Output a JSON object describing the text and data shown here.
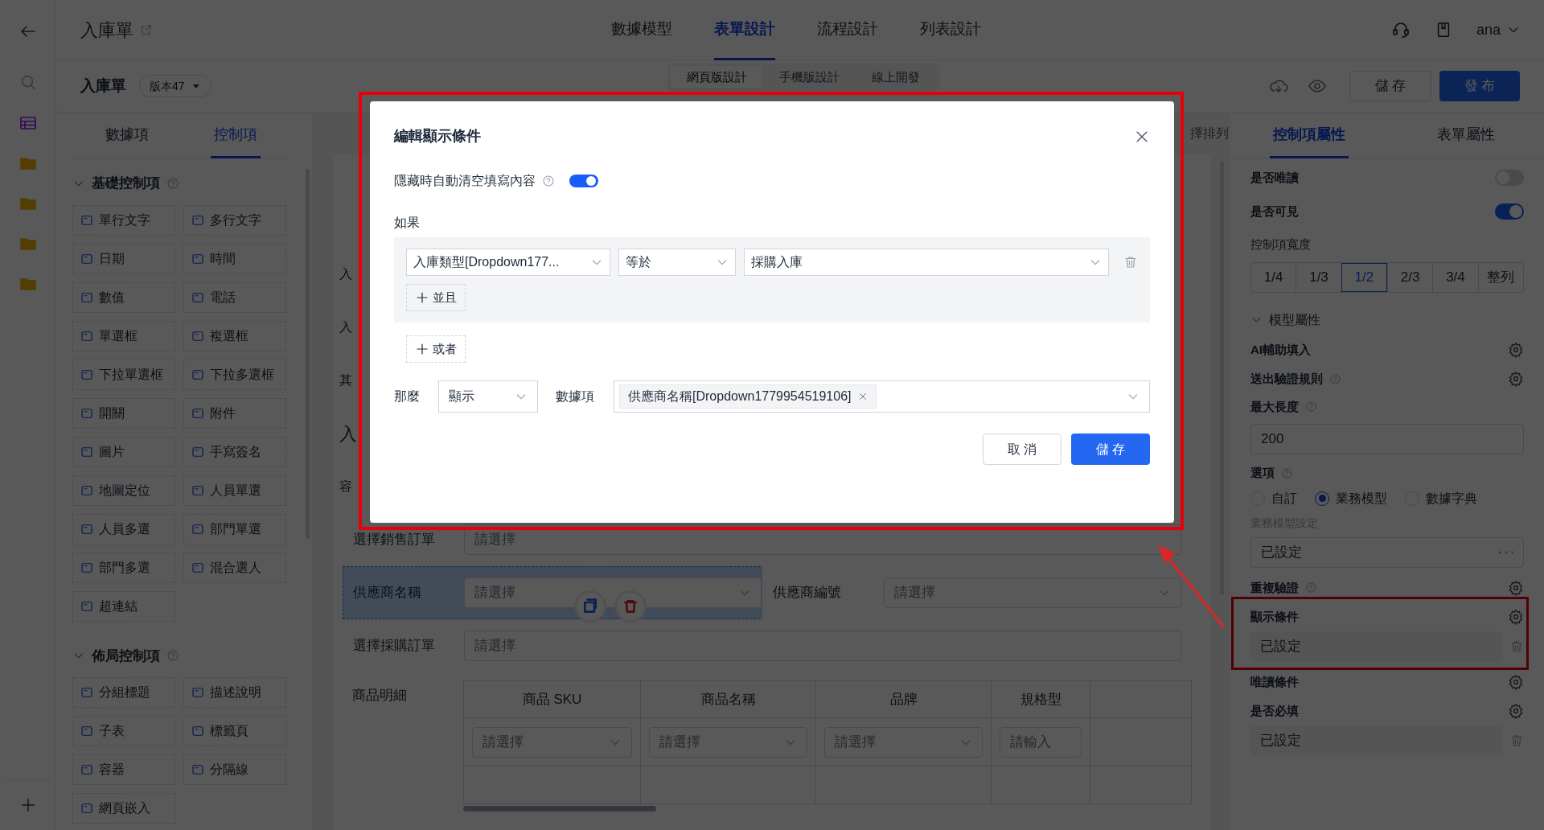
{
  "header": {
    "title": "入庫單",
    "tabs": [
      {
        "label": "數據模型",
        "selected": false
      },
      {
        "label": "表單設計",
        "selected": true
      },
      {
        "label": "流程設計",
        "selected": false
      },
      {
        "label": "列表設計",
        "selected": false
      }
    ],
    "user": "ana"
  },
  "toolbar": {
    "form_name": "入庫單",
    "version": "版本47",
    "design_tabs": [
      {
        "label": "網頁版設計",
        "selected": true
      },
      {
        "label": "手機版設計",
        "selected": false
      },
      {
        "label": "線上開發",
        "selected": false
      }
    ],
    "save": "儲 存",
    "publish": "發 布"
  },
  "left_panel": {
    "tabs": [
      {
        "label": "數據項",
        "selected": false
      },
      {
        "label": "控制項",
        "selected": true
      }
    ],
    "sections": [
      {
        "title": "基礎控制項",
        "expanded": true,
        "items": [
          "單行文字",
          "多行文字",
          "日期",
          "時間",
          "數值",
          "電話",
          "單選框",
          "複選框",
          "下拉單選框",
          "下拉多選框",
          "開關",
          "附件",
          "圖片",
          "手寫簽名",
          "地圖定位",
          "人員單選",
          "人員多選",
          "部門單選",
          "部門多選",
          "混合選人",
          "超連結"
        ]
      },
      {
        "title": "佈局控制項",
        "expanded": true,
        "items": [
          "分組標題",
          "描述說明",
          "子表",
          "標籤頁",
          "容器",
          "分隔線",
          "網頁嵌入"
        ]
      }
    ]
  },
  "canvas": {
    "corner_text": "擇排列",
    "side_fragments": [
      {
        "text": "入",
        "kind": "label"
      },
      {
        "text": "入",
        "kind": "label"
      },
      {
        "text": "其",
        "kind": "label"
      },
      {
        "text": "入",
        "kind": "heading"
      },
      {
        "text": "容",
        "kind": "label"
      }
    ],
    "rows": [
      {
        "fields": [
          {
            "label": "選擇銷售訂單",
            "placeholder": "請選擇",
            "selected": false,
            "dropdown": false
          }
        ]
      },
      {
        "fields": [
          {
            "label": "供應商名稱",
            "placeholder": "請選擇",
            "selected": true,
            "dropdown": true
          },
          {
            "label": "供應商編號",
            "placeholder": "請選擇",
            "selected": false,
            "dropdown": true
          }
        ]
      },
      {
        "fields": [
          {
            "label": "選擇採購訂單",
            "placeholder": "請選擇",
            "selected": false,
            "dropdown": false
          }
        ]
      }
    ],
    "table": {
      "label": "商品明細",
      "columns": [
        "商品 SKU",
        "商品名稱",
        "品牌",
        "規格型"
      ],
      "cells": [
        {
          "placeholder": "請選擇",
          "kind": "select"
        },
        {
          "placeholder": "請選擇",
          "kind": "select"
        },
        {
          "placeholder": "請選擇",
          "kind": "select"
        },
        {
          "placeholder": "請輸入",
          "kind": "input"
        }
      ]
    }
  },
  "right_panel": {
    "tabs": [
      {
        "label": "控制項屬性",
        "selected": true
      },
      {
        "label": "表單屬性",
        "selected": false
      }
    ],
    "props": [
      {
        "kind": "toggle",
        "label": "是否唯讀",
        "on": false
      },
      {
        "kind": "toggle",
        "label": "是否可見",
        "on": true
      },
      {
        "kind": "segmented",
        "label": "控制項寬度",
        "options": [
          {
            "label": "1/4",
            "selected": false
          },
          {
            "label": "1/3",
            "selected": false
          },
          {
            "label": "1/2",
            "selected": true
          },
          {
            "label": "2/3",
            "selected": false
          },
          {
            "label": "3/4",
            "selected": false
          },
          {
            "label": "整列",
            "selected": false
          }
        ]
      },
      {
        "kind": "section",
        "label": "模型屬性",
        "expanded": true
      },
      {
        "kind": "gear",
        "label": "AI輔助填入",
        "help": false
      },
      {
        "kind": "gear",
        "label": "送出驗證規則",
        "help": true
      },
      {
        "kind": "text",
        "label": "最大長度",
        "help": true,
        "value": "200"
      },
      {
        "kind": "radio",
        "label": "選項",
        "help": true,
        "options": [
          {
            "label": "自訂",
            "selected": false
          },
          {
            "label": "業務模型",
            "selected": true
          },
          {
            "label": "數據字典",
            "selected": false
          }
        ]
      },
      {
        "kind": "more",
        "label": "業務模型設定",
        "value": "已設定"
      },
      {
        "kind": "gear",
        "label": "重複驗證",
        "help": true
      },
      {
        "kind": "gear",
        "label": "顯示條件",
        "help": false,
        "value": "已設定",
        "highlighted": true
      },
      {
        "kind": "gear",
        "label": "唯讀條件",
        "help": false
      },
      {
        "kind": "gear",
        "label": "是否必填",
        "help": false,
        "value": "已設定"
      }
    ]
  },
  "modal": {
    "title": "編輯顯示條件",
    "clear_on_hide": {
      "label": "隱藏時自動清空填寫內容",
      "on": true
    },
    "if_label": "如果",
    "conditions": [
      {
        "field": "入庫類型[Dropdown177...",
        "operator": "等於",
        "value": "採購入庫"
      }
    ],
    "and_button": "並且",
    "or_button": "或者",
    "then_label": "那麼",
    "action": "顯示",
    "data_label": "數據項",
    "data_tags": [
      "供應商名稱[Dropdown1779954519106]"
    ],
    "buttons": [
      {
        "label": "取 消",
        "kind": "secondary"
      },
      {
        "label": "儲 存",
        "kind": "primary"
      }
    ]
  }
}
